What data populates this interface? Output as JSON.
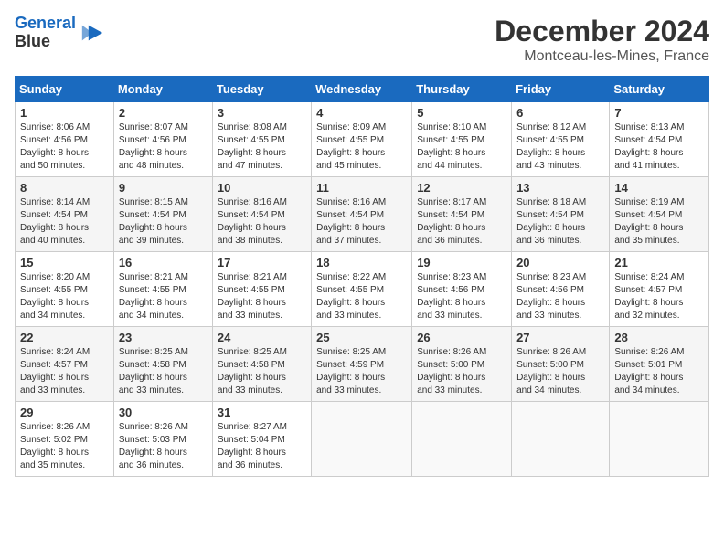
{
  "header": {
    "logo_line1": "General",
    "logo_line2": "Blue",
    "month": "December 2024",
    "location": "Montceau-les-Mines, France"
  },
  "weekdays": [
    "Sunday",
    "Monday",
    "Tuesday",
    "Wednesday",
    "Thursday",
    "Friday",
    "Saturday"
  ],
  "weeks": [
    [
      {
        "day": "1",
        "info": "Sunrise: 8:06 AM\nSunset: 4:56 PM\nDaylight: 8 hours\nand 50 minutes."
      },
      {
        "day": "2",
        "info": "Sunrise: 8:07 AM\nSunset: 4:56 PM\nDaylight: 8 hours\nand 48 minutes."
      },
      {
        "day": "3",
        "info": "Sunrise: 8:08 AM\nSunset: 4:55 PM\nDaylight: 8 hours\nand 47 minutes."
      },
      {
        "day": "4",
        "info": "Sunrise: 8:09 AM\nSunset: 4:55 PM\nDaylight: 8 hours\nand 45 minutes."
      },
      {
        "day": "5",
        "info": "Sunrise: 8:10 AM\nSunset: 4:55 PM\nDaylight: 8 hours\nand 44 minutes."
      },
      {
        "day": "6",
        "info": "Sunrise: 8:12 AM\nSunset: 4:55 PM\nDaylight: 8 hours\nand 43 minutes."
      },
      {
        "day": "7",
        "info": "Sunrise: 8:13 AM\nSunset: 4:54 PM\nDaylight: 8 hours\nand 41 minutes."
      }
    ],
    [
      {
        "day": "8",
        "info": "Sunrise: 8:14 AM\nSunset: 4:54 PM\nDaylight: 8 hours\nand 40 minutes."
      },
      {
        "day": "9",
        "info": "Sunrise: 8:15 AM\nSunset: 4:54 PM\nDaylight: 8 hours\nand 39 minutes."
      },
      {
        "day": "10",
        "info": "Sunrise: 8:16 AM\nSunset: 4:54 PM\nDaylight: 8 hours\nand 38 minutes."
      },
      {
        "day": "11",
        "info": "Sunrise: 8:16 AM\nSunset: 4:54 PM\nDaylight: 8 hours\nand 37 minutes."
      },
      {
        "day": "12",
        "info": "Sunrise: 8:17 AM\nSunset: 4:54 PM\nDaylight: 8 hours\nand 36 minutes."
      },
      {
        "day": "13",
        "info": "Sunrise: 8:18 AM\nSunset: 4:54 PM\nDaylight: 8 hours\nand 36 minutes."
      },
      {
        "day": "14",
        "info": "Sunrise: 8:19 AM\nSunset: 4:54 PM\nDaylight: 8 hours\nand 35 minutes."
      }
    ],
    [
      {
        "day": "15",
        "info": "Sunrise: 8:20 AM\nSunset: 4:55 PM\nDaylight: 8 hours\nand 34 minutes."
      },
      {
        "day": "16",
        "info": "Sunrise: 8:21 AM\nSunset: 4:55 PM\nDaylight: 8 hours\nand 34 minutes."
      },
      {
        "day": "17",
        "info": "Sunrise: 8:21 AM\nSunset: 4:55 PM\nDaylight: 8 hours\nand 33 minutes."
      },
      {
        "day": "18",
        "info": "Sunrise: 8:22 AM\nSunset: 4:55 PM\nDaylight: 8 hours\nand 33 minutes."
      },
      {
        "day": "19",
        "info": "Sunrise: 8:23 AM\nSunset: 4:56 PM\nDaylight: 8 hours\nand 33 minutes."
      },
      {
        "day": "20",
        "info": "Sunrise: 8:23 AM\nSunset: 4:56 PM\nDaylight: 8 hours\nand 33 minutes."
      },
      {
        "day": "21",
        "info": "Sunrise: 8:24 AM\nSunset: 4:57 PM\nDaylight: 8 hours\nand 32 minutes."
      }
    ],
    [
      {
        "day": "22",
        "info": "Sunrise: 8:24 AM\nSunset: 4:57 PM\nDaylight: 8 hours\nand 33 minutes."
      },
      {
        "day": "23",
        "info": "Sunrise: 8:25 AM\nSunset: 4:58 PM\nDaylight: 8 hours\nand 33 minutes."
      },
      {
        "day": "24",
        "info": "Sunrise: 8:25 AM\nSunset: 4:58 PM\nDaylight: 8 hours\nand 33 minutes."
      },
      {
        "day": "25",
        "info": "Sunrise: 8:25 AM\nSunset: 4:59 PM\nDaylight: 8 hours\nand 33 minutes."
      },
      {
        "day": "26",
        "info": "Sunrise: 8:26 AM\nSunset: 5:00 PM\nDaylight: 8 hours\nand 33 minutes."
      },
      {
        "day": "27",
        "info": "Sunrise: 8:26 AM\nSunset: 5:00 PM\nDaylight: 8 hours\nand 34 minutes."
      },
      {
        "day": "28",
        "info": "Sunrise: 8:26 AM\nSunset: 5:01 PM\nDaylight: 8 hours\nand 34 minutes."
      }
    ],
    [
      {
        "day": "29",
        "info": "Sunrise: 8:26 AM\nSunset: 5:02 PM\nDaylight: 8 hours\nand 35 minutes."
      },
      {
        "day": "30",
        "info": "Sunrise: 8:26 AM\nSunset: 5:03 PM\nDaylight: 8 hours\nand 36 minutes."
      },
      {
        "day": "31",
        "info": "Sunrise: 8:27 AM\nSunset: 5:04 PM\nDaylight: 8 hours\nand 36 minutes."
      },
      {
        "day": "",
        "info": ""
      },
      {
        "day": "",
        "info": ""
      },
      {
        "day": "",
        "info": ""
      },
      {
        "day": "",
        "info": ""
      }
    ]
  ]
}
